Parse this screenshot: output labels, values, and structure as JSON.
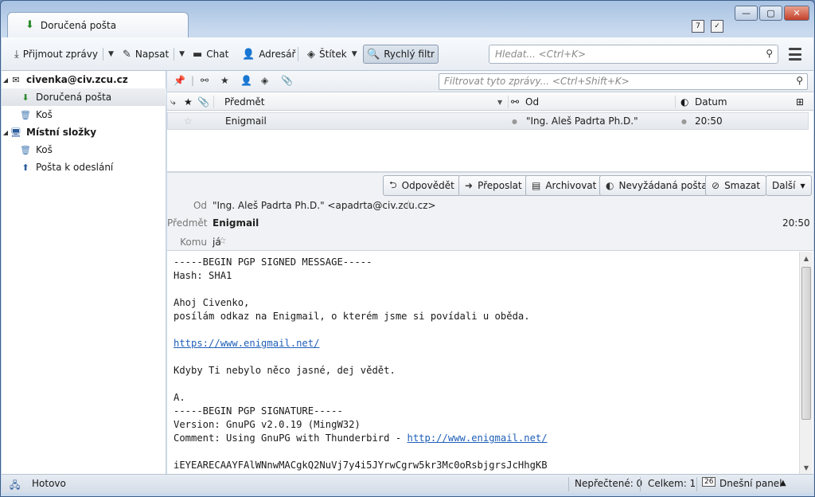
{
  "window": {
    "tab_label": "Doručená pošta",
    "controls": {
      "minimize": "—",
      "maximize": "▢",
      "close": "✕"
    },
    "tab_icons": {
      "calendar": "7",
      "tasks": "✓"
    }
  },
  "toolbar": {
    "get_messages": "Přijmout zprávy",
    "write": "Napsat",
    "chat": "Chat",
    "address_book": "Adresář",
    "tag": "Štítek",
    "quick_filter": "Rychlý filtr",
    "search_placeholder": "Hledat... <Ctrl+K>"
  },
  "folders": {
    "account": "civenka@civ.zcu.cz",
    "inbox": "Doručená pošta",
    "trash1": "Koš",
    "local_folders": "Místní složky",
    "trash2": "Koš",
    "outbox": "Pošta k odeslání"
  },
  "filter": {
    "placeholder": "Filtrovat tyto zprávy... <Ctrl+Shift+K>"
  },
  "columns": {
    "subject": "Předmět",
    "from": "Od",
    "date": "Datum"
  },
  "messages": [
    {
      "subject": "Enigmail",
      "from": "\"Ing. Aleš Padrta Ph.D.\"",
      "date": "20:50"
    }
  ],
  "msg_buttons": {
    "reply": "Odpovědět",
    "forward": "Přeposlat",
    "archive": "Archivovat",
    "junk": "Nevyžádaná pošta",
    "delete": "Smazat",
    "more": "Další"
  },
  "header": {
    "from_label": "Od",
    "from_value": "\"Ing. Aleš Padrta Ph.D.\" <apadrta@civ.zcu.cz>",
    "subject_label": "Předmět",
    "subject_value": "Enigmail",
    "time": "20:50",
    "to_label": "Komu",
    "to_value": "já"
  },
  "body": {
    "l1": "-----BEGIN PGP SIGNED MESSAGE-----",
    "l2": "Hash: SHA1",
    "l3": "Ahoj Civenko,",
    "l4": "posílám odkaz na Enigmail, o kterém jsme si povídali u oběda.",
    "link1": "https://www.enigmail.net/",
    "l5": "Kdyby Ti nebylo něco jasné, dej vědět.",
    "l6": "A.",
    "l7": "-----BEGIN PGP SIGNATURE-----",
    "l8": "Version: GnuPG v2.0.19 (MingW32)",
    "l9": "Comment: Using GnuPG with Thunderbird - ",
    "link2": "http://www.enigmail.net/",
    "l10": "iEYEARECAAYFAlWNnwMACgkQ2NuVj7y4i5JYrwCgrw5kr3Mc0oRsbjgrsJcHhgKB"
  },
  "status": {
    "text": "Hotovo",
    "unread": "Nepřečtené: 0",
    "total": "Celkem: 1",
    "today_pane": "Dnešní panel",
    "calendar_day": "26"
  }
}
